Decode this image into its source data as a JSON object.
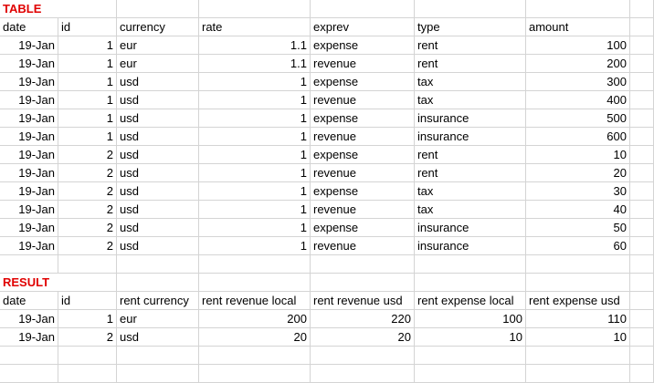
{
  "table_title": "TABLE",
  "table_headers": [
    "date",
    "id",
    "currency",
    "rate",
    "exprev",
    "type",
    "amount"
  ],
  "table_rows": [
    [
      "19-Jan",
      "1",
      "eur",
      "1.1",
      "expense",
      "rent",
      "100"
    ],
    [
      "19-Jan",
      "1",
      "eur",
      "1.1",
      "revenue",
      "rent",
      "200"
    ],
    [
      "19-Jan",
      "1",
      "usd",
      "1",
      "expense",
      "tax",
      "300"
    ],
    [
      "19-Jan",
      "1",
      "usd",
      "1",
      "revenue",
      "tax",
      "400"
    ],
    [
      "19-Jan",
      "1",
      "usd",
      "1",
      "expense",
      "insurance",
      "500"
    ],
    [
      "19-Jan",
      "1",
      "usd",
      "1",
      "revenue",
      "insurance",
      "600"
    ],
    [
      "19-Jan",
      "2",
      "usd",
      "1",
      "expense",
      "rent",
      "10"
    ],
    [
      "19-Jan",
      "2",
      "usd",
      "1",
      "revenue",
      "rent",
      "20"
    ],
    [
      "19-Jan",
      "2",
      "usd",
      "1",
      "expense",
      "tax",
      "30"
    ],
    [
      "19-Jan",
      "2",
      "usd",
      "1",
      "revenue",
      "tax",
      "40"
    ],
    [
      "19-Jan",
      "2",
      "usd",
      "1",
      "expense",
      "insurance",
      "50"
    ],
    [
      "19-Jan",
      "2",
      "usd",
      "1",
      "revenue",
      "insurance",
      "60"
    ]
  ],
  "result_title": "RESULT",
  "result_headers": [
    "date",
    "id",
    "rent currency",
    "rent revenue local",
    "rent revenue usd",
    "rent expense local",
    "rent expense usd"
  ],
  "result_rows": [
    [
      "19-Jan",
      "1",
      "eur",
      "200",
      "220",
      "100",
      "110"
    ],
    [
      "19-Jan",
      "2",
      "usd",
      "20",
      "20",
      "10",
      "10"
    ]
  ],
  "colors": {
    "title": "#e00000",
    "gridline": "#d4d4d4"
  }
}
